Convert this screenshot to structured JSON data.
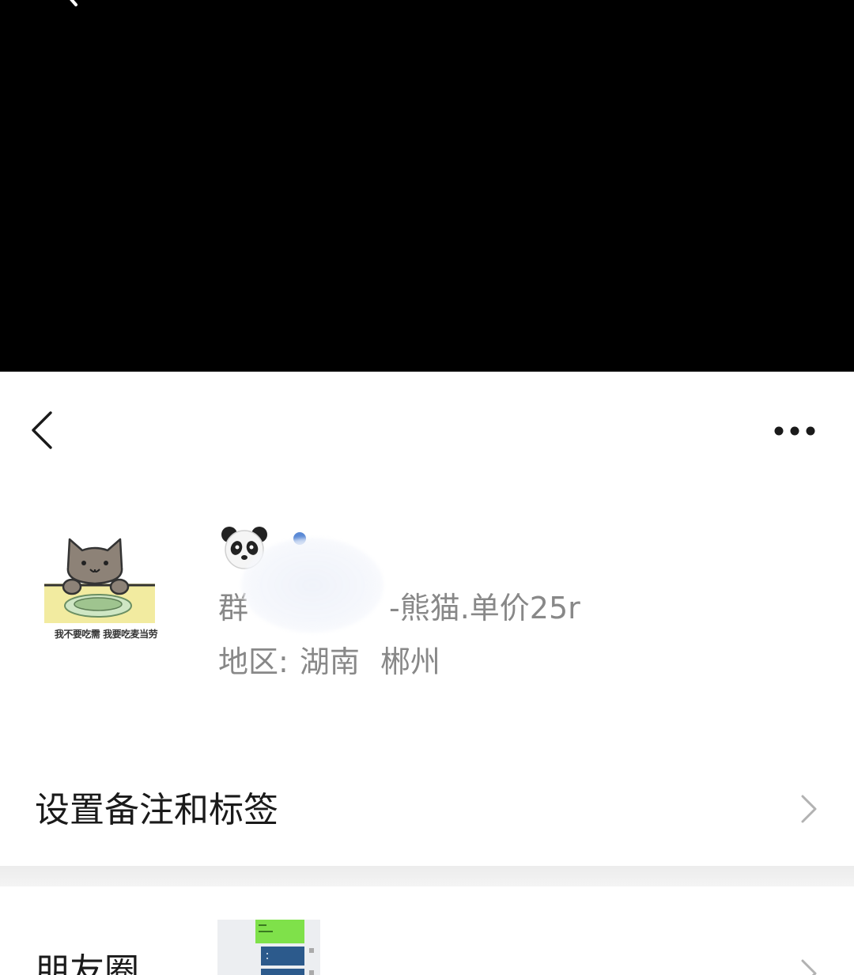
{
  "video_area": {
    "background": "#000000",
    "icon": "back-chevron-icon"
  },
  "top_bar": {
    "back_icon": "back-chevron-icon",
    "more_icon": "more-dots-icon"
  },
  "profile": {
    "avatar_icon": "cat-eating-sticker-avatar",
    "avatar_caption": "我不要吃需 我要吃麦当劳",
    "nickname_emoji": "panda-emoji-icon",
    "remark_prefix": "群",
    "remark_suffix": "-熊猫.单价25r",
    "region_label": "地区:",
    "region_province": "湖南",
    "region_city": "郴州"
  },
  "list": {
    "remark_and_tags": "设置备注和标签",
    "moments": "朋友圈"
  },
  "colors": {
    "text_primary": "#1a1a1a",
    "text_secondary": "#888888",
    "chevron": "#b2b2b2",
    "divider": "#ececec",
    "moments_green": "#7fe14a",
    "moments_blue": "#2c5a8c"
  }
}
